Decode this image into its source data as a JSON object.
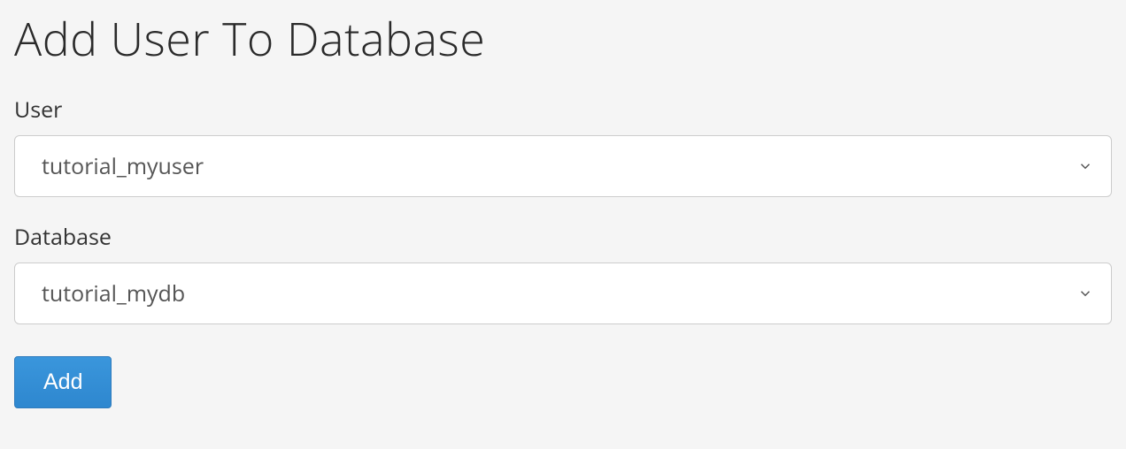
{
  "page": {
    "title": "Add User To Database"
  },
  "form": {
    "user": {
      "label": "User",
      "selected": "tutorial_myuser"
    },
    "database": {
      "label": "Database",
      "selected": "tutorial_mydb"
    },
    "submit": {
      "label": "Add"
    }
  },
  "colors": {
    "primary": "#2f8dd6",
    "background": "#f5f5f5",
    "border": "#ccc"
  }
}
